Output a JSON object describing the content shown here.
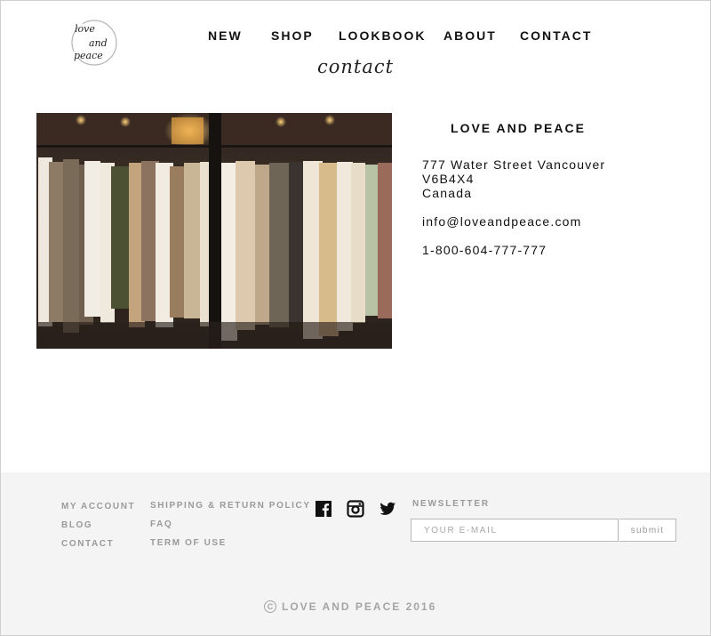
{
  "brand": {
    "logo_line1": "love",
    "logo_line2": "and",
    "logo_line3": "peace"
  },
  "nav": {
    "items": [
      "NEW",
      "SHOP",
      "LOOKBOOK",
      "ABOUT",
      "CONTACT"
    ]
  },
  "page": {
    "title": "contact"
  },
  "store": {
    "name": "LOVE AND PEACE",
    "address_line1": "777 Water Street Vancouver",
    "address_line2": "V6B4X4",
    "address_line3": "Canada",
    "email": "info@loveandpeace.com",
    "phone": "1-800-604-777-777"
  },
  "footer": {
    "col1": [
      "MY ACCOUNT",
      "BLOG",
      "CONTACT"
    ],
    "col2": [
      "SHIPPING & RETURN POLICY",
      "FAQ",
      "TERM OF USE"
    ],
    "social_icons": [
      "facebook-icon",
      "instagram-icon",
      "twitter-icon"
    ],
    "newsletter": {
      "label": "NEWSLETTER",
      "placeholder": "YOUR E-MAIL",
      "value": "",
      "submit_label": "submit"
    },
    "copyright_symbol": "C",
    "copyright": "LOVE AND PEACE 2016"
  },
  "colors": {
    "footer_bg": "#f4f4f4",
    "footer_text": "#9a9a9a",
    "text": "#111111"
  }
}
